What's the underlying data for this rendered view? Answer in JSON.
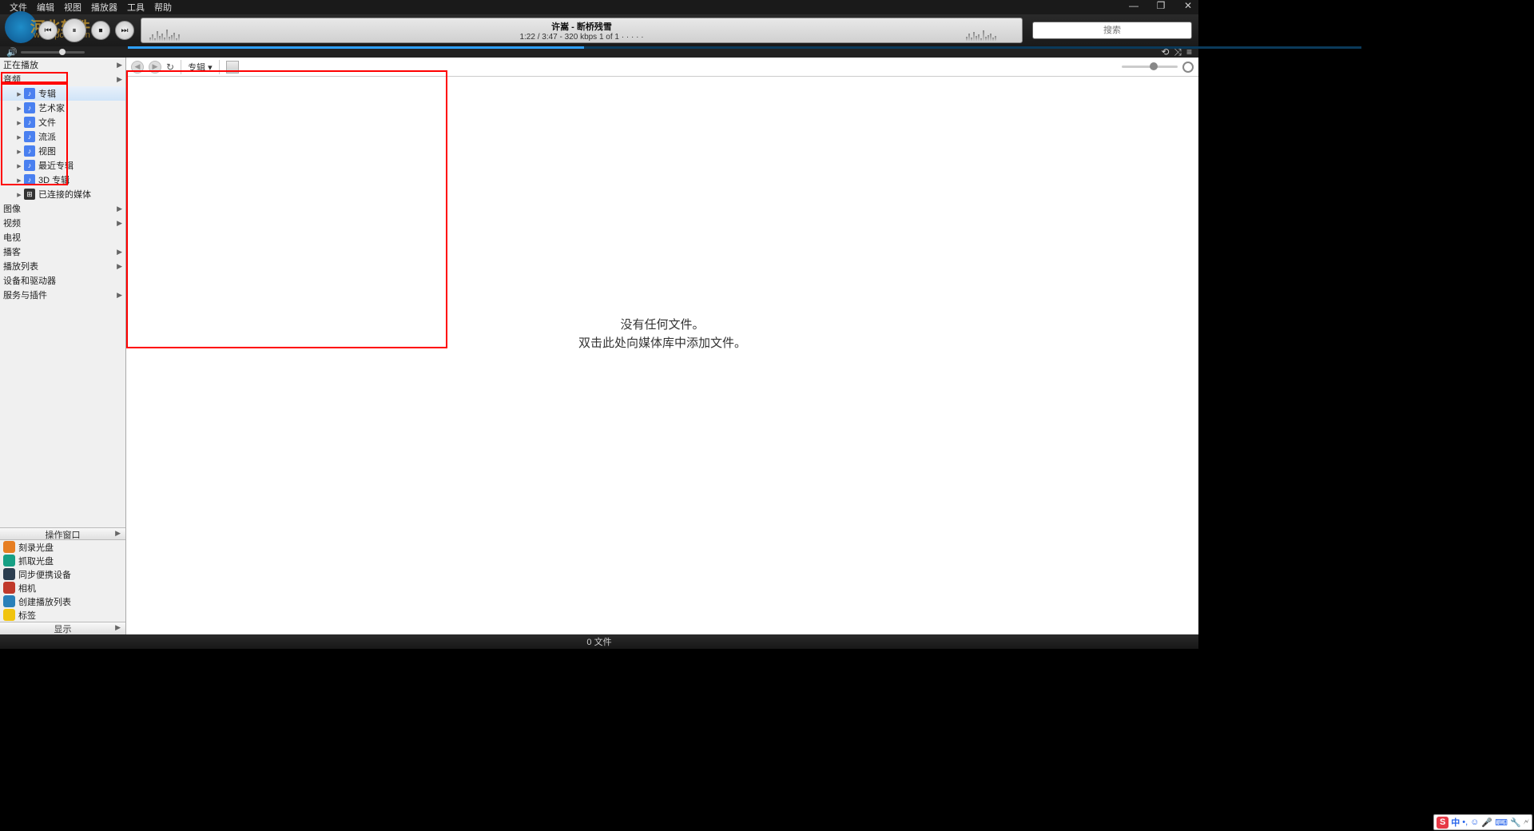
{
  "menu": {
    "file": "文件",
    "edit": "编辑",
    "view": "视图",
    "player": "播放器",
    "tools": "工具",
    "help": "帮助"
  },
  "window": {
    "min": "—",
    "max": "❐",
    "close": "✕"
  },
  "track": {
    "title": "许嵩 - 断桥残雪",
    "meta": "1:22 / 3:47 - 320 kbps   1 of 1   · · · · ·"
  },
  "search": {
    "placeholder": "搜索"
  },
  "sidebar": {
    "now_playing": "正在播放",
    "audio": "音频",
    "audio_children": [
      "专辑",
      "艺术家",
      "文件",
      "流派",
      "视图",
      "最近专辑",
      "3D 专辑"
    ],
    "connected_media": "已连接的媒体",
    "image": "图像",
    "video": "视频",
    "tv": "电视",
    "podcast": "播客",
    "playlist": "播放列表",
    "devices": "设备和驱动器",
    "services": "服务与插件",
    "ops_title": "操作窗口",
    "ops": [
      "刻录光盘",
      "抓取光盘",
      "同步便携设备",
      "相机",
      "创建播放列表",
      "标签"
    ],
    "show": "显示"
  },
  "toolbar": {
    "group": "专辑 ▾"
  },
  "empty": {
    "l1": "没有任何文件。",
    "l2": "双击此处向媒体库中添加文件。"
  },
  "status": {
    "text": "0 文件"
  },
  "ime": {
    "logo": "S",
    "lang": "中",
    "punct": "•,",
    "face": "☺",
    "mic": "🎤",
    "kbd": "⌨",
    "tool": "🔧",
    "wrench": "🗲"
  },
  "colors": {
    "op_icons": [
      "#e67e22",
      "#16a085",
      "#2c3e50",
      "#c0392b",
      "#2980b9",
      "#f1c40f"
    ]
  },
  "watermark": {
    "main": "河北软件",
    "sub": "www.pc059.cn"
  }
}
